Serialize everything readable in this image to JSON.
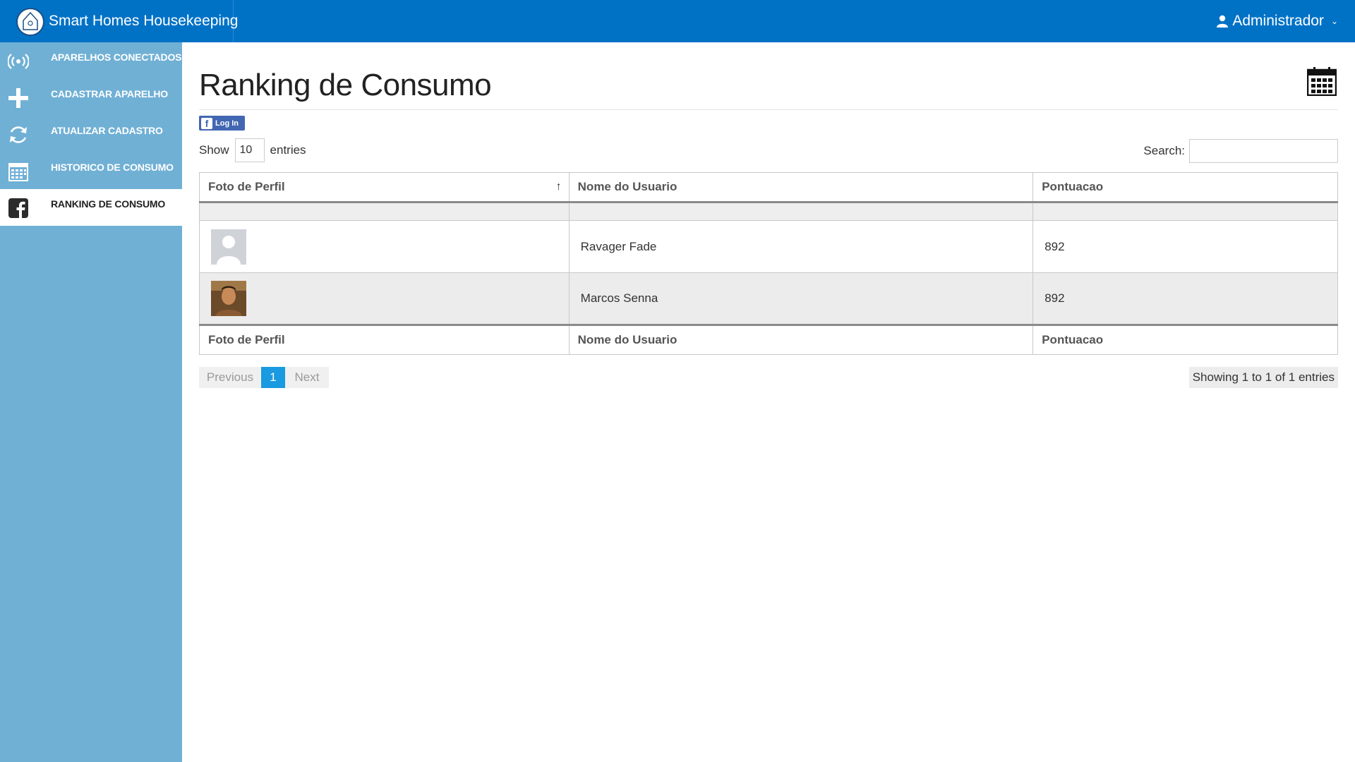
{
  "app": {
    "title": "Smart Homes Housekeeping"
  },
  "topbar": {
    "user_label": "Administrador",
    "caret": "⌄"
  },
  "sidebar": {
    "items": [
      {
        "label": "APARELHOS CONECTADOS",
        "icon": "wireless-signal-icon"
      },
      {
        "label": "CADASTRAR APARELHO",
        "icon": "plus-icon"
      },
      {
        "label": "ATUALIZAR CADASTRO",
        "icon": "refresh-icon"
      },
      {
        "label": "HISTORICO DE CONSUMO",
        "icon": "calendar-icon"
      },
      {
        "label": "RANKING DE CONSUMO",
        "icon": "facebook-icon",
        "active": true
      }
    ]
  },
  "page": {
    "title": "Ranking de Consumo"
  },
  "facebook": {
    "login_label": "Log In",
    "f": "f"
  },
  "table_controls": {
    "show_label": "Show",
    "length_value": "10",
    "entries_label": "entries",
    "search_label": "Search:",
    "search_value": ""
  },
  "table": {
    "headers": [
      "Foto de Perfil",
      "Nome do Usuario",
      "Pontuacao"
    ],
    "sort_indicator": "↑",
    "rows": [
      {
        "photo": "default-avatar",
        "name": "Ravager Fade",
        "score": "892"
      },
      {
        "photo": "user-photo",
        "name": "Marcos Senna",
        "score": "892"
      }
    ],
    "footers": [
      "Foto de Perfil",
      "Nome do Usuario",
      "Pontuacao"
    ]
  },
  "pagination": {
    "previous": "Previous",
    "current": "1",
    "next": "Next"
  },
  "info": {
    "text": "Showing 1 to 1 of 1 entries"
  },
  "colors": {
    "topbar": "#0072c6",
    "sidebar": "#70b0d5",
    "page_active": "#1a9ae0",
    "facebook": "#4267b2"
  }
}
